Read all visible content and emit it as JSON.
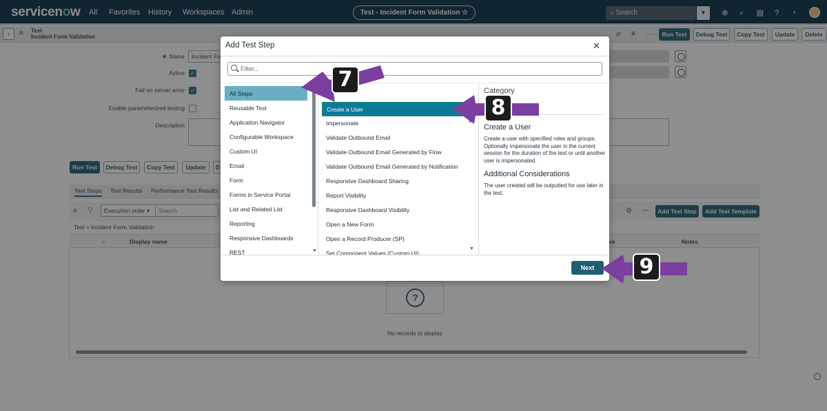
{
  "nav": {
    "logo_prefix": "servicen",
    "logo_o": "o",
    "logo_suffix": "w",
    "items": [
      "All",
      "Favorites",
      "History",
      "Workspaces",
      "Admin"
    ],
    "center_title": "Test - Incident Form Validation ☆",
    "search_placeholder": "Search"
  },
  "record": {
    "type": "Test",
    "name": "Incident Form Validation"
  },
  "header_buttons": [
    "Run Test",
    "Debug Test",
    "Copy Test",
    "Update",
    "Delete"
  ],
  "form": {
    "name_label": "Name",
    "name_value": "Incident Fo",
    "active_label": "Active",
    "fail_label": "Fail on server error",
    "param_label": "Enable parameterized testing",
    "description_label": "Description"
  },
  "form_buttons": [
    "Run Test",
    "Debug Test",
    "Copy Test",
    "Update",
    "D"
  ],
  "tabs": [
    "Test Steps",
    "Test Results",
    "Performance Test Results"
  ],
  "list": {
    "order_select": "Execution order ▾",
    "search_placeholder": "Search",
    "filter_text": "Test = Incident Form Validation",
    "col_display_name": "Display name",
    "col_active": "ve",
    "col_notes": "Notes",
    "add_step_button": "Add Test Step",
    "add_template_button": "Add Test Template",
    "empty_text": "No records to display"
  },
  "modal": {
    "title": "Add Test Step",
    "filter_placeholder": "Filter...",
    "categories": [
      "All Steps",
      "Reusable Test",
      "Application Navigator",
      "Configurable Workspace",
      "Custom UI",
      "Email",
      "Form",
      "Forms in Service Portal",
      "List and Related List",
      "Reporting",
      "Responsive Dashboards",
      "REST"
    ],
    "selected_category": "All Steps",
    "steps": [
      "Create a User",
      "Impersonate",
      "Validate Outbound Email",
      "Validate Outbound Email Generated by Flow",
      "Validate Outbound Email Generated by Notification",
      "Responsive Dashboard Sharing",
      "Report Visibility",
      "Responsive Dashboard Visibility",
      "Open a New Form",
      "Open a Record Producer (SP)",
      "Set Component Values (Custom UI)"
    ],
    "selected_step": "Create a User",
    "category_label": "Category",
    "desc_title": "Create a User",
    "desc_text": "Create a user with specified roles and groups. Optionally impersonate the user in the current session for the duration of the test or until another user is impersonated.",
    "desc_subtitle": "Additional Considerations",
    "desc_text2": "The user created will be outputted for use later in the test.",
    "next_button": "Next"
  },
  "callouts": [
    "7",
    "8",
    "9"
  ],
  "colors": {
    "nav_bg": "#032d42",
    "primary": "#1f5d73",
    "selected_step": "#0e7a9a",
    "selected_category": "#6aaec6",
    "callout_arrow": "#7b3fa0"
  }
}
